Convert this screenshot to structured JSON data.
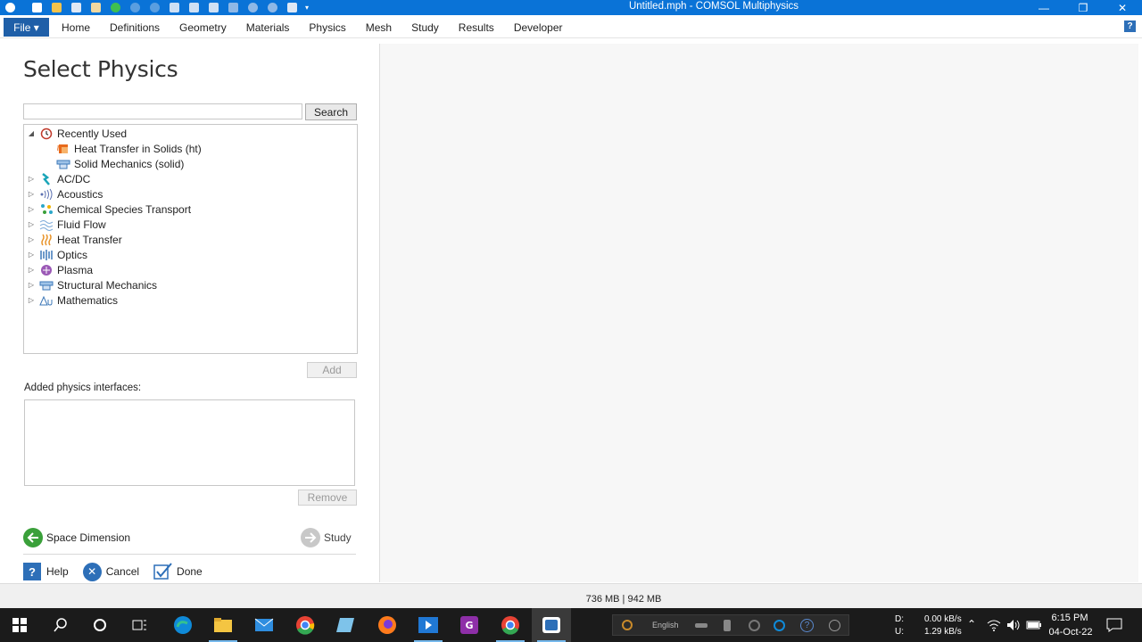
{
  "window": {
    "title": "Untitled.mph - COMSOL Multiphysics",
    "minimize_glyph": "—",
    "restore_glyph": "❐",
    "close_glyph": "✕"
  },
  "ribbon": {
    "file_label": "File ▾",
    "tabs": [
      "Home",
      "Definitions",
      "Geometry",
      "Materials",
      "Physics",
      "Mesh",
      "Study",
      "Results",
      "Developer"
    ],
    "help_label": "?"
  },
  "select_physics": {
    "title": "Select Physics",
    "search": {
      "value": "",
      "placeholder": "",
      "button_label": "Search"
    },
    "tree": [
      {
        "label": "Recently Used",
        "icon": "clock-icon",
        "expanded": true,
        "level": 0
      },
      {
        "label": "Heat Transfer in Solids (ht)",
        "icon": "heat-solid-icon",
        "level": 1
      },
      {
        "label": "Solid Mechanics (solid)",
        "icon": "solid-mechanics-icon",
        "level": 1
      },
      {
        "label": "AC/DC",
        "icon": "acdc-icon",
        "expanded": false,
        "level": 0
      },
      {
        "label": "Acoustics",
        "icon": "acoustics-icon",
        "expanded": false,
        "level": 0
      },
      {
        "label": "Chemical Species Transport",
        "icon": "chemical-icon",
        "expanded": false,
        "level": 0
      },
      {
        "label": "Fluid Flow",
        "icon": "fluid-flow-icon",
        "expanded": false,
        "level": 0
      },
      {
        "label": "Heat Transfer",
        "icon": "heat-transfer-icon",
        "expanded": false,
        "level": 0
      },
      {
        "label": "Optics",
        "icon": "optics-icon",
        "expanded": false,
        "level": 0
      },
      {
        "label": "Plasma",
        "icon": "plasma-icon",
        "expanded": false,
        "level": 0
      },
      {
        "label": "Structural Mechanics",
        "icon": "structural-icon",
        "expanded": false,
        "level": 0
      },
      {
        "label": "Mathematics",
        "icon": "mathematics-icon",
        "expanded": false,
        "level": 0
      }
    ],
    "add_label": "Add",
    "added_interfaces_label": "Added physics interfaces:",
    "remove_label": "Remove",
    "back_label": "Space Dimension",
    "next_label": "Study",
    "help_label": "Help",
    "cancel_label": "Cancel",
    "done_label": "Done"
  },
  "status": {
    "memory": "736 MB | 942 MB"
  },
  "taskbar": {
    "language": "English",
    "drive_d": "D:",
    "drive_u": "U:",
    "download_rate": "0.00 kB/s",
    "upload_rate": "1.29 kB/s",
    "time": "6:15 PM",
    "date": "04-Oct-22"
  },
  "colors": {
    "titlebar": "#0a73d7",
    "file_button": "#1f5fa8",
    "back_arrow": "#3aa03a",
    "next_arrow": "#c8c8c8",
    "cancel": "#2d6fb8"
  }
}
